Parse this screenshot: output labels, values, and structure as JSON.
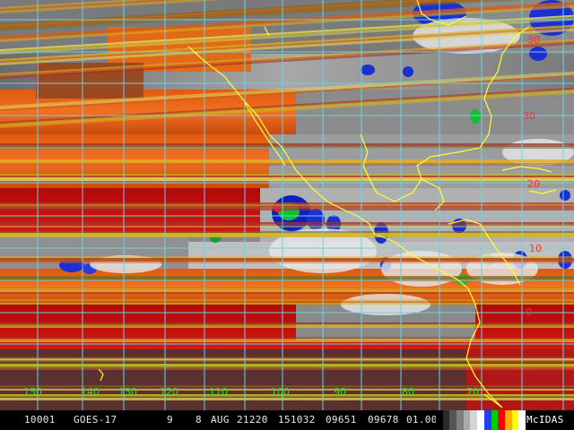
{
  "statusbar": {
    "frame_id": "10001",
    "satellite": "GOES-17",
    "band": "9",
    "day": "8",
    "month": "AUG",
    "year_julian": "21220",
    "time": "151032",
    "lat_code": "09651",
    "lon_code": "09678",
    "zoom": "01.00",
    "software": "McIDAS"
  },
  "grid": {
    "lat_labels": [
      "30",
      "30",
      "20",
      "10",
      "0"
    ],
    "lon_labels": [
      "150",
      "140",
      "130",
      "120",
      "110",
      "100",
      "90",
      "80",
      "70"
    ]
  },
  "colors": {
    "grid_line": "#6fd0e0",
    "coastline": "#ffff33",
    "lat_label": "#ff3030",
    "lon_label": "#33dd33",
    "dry_orange": "#e06010",
    "dry_red": "#c01010",
    "moist_gray": "#9a9a9a",
    "cold_blue": "#1020d0",
    "cold_green": "#10c030"
  },
  "color_scale": [
    "#000000",
    "#2a2a2a",
    "#555555",
    "#808080",
    "#aaaaaa",
    "#d5d5d5",
    "#ffffff",
    "#2040ff",
    "#00d000",
    "#ff0000",
    "#ffb000",
    "#ffff00",
    "#ffffff"
  ]
}
